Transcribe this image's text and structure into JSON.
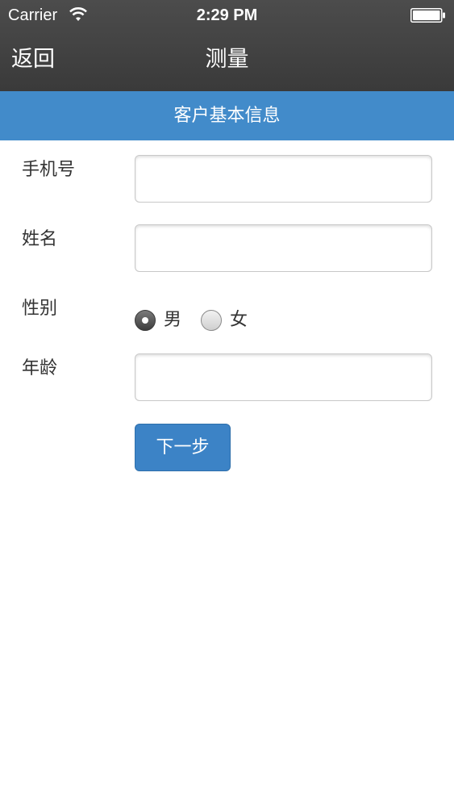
{
  "status_bar": {
    "carrier": "Carrier",
    "time": "2:29 PM",
    "wifi_icon": "wifi-icon",
    "battery_icon": "battery-icon"
  },
  "nav": {
    "back_label": "返回",
    "title": "测量"
  },
  "section": {
    "title": "客户基本信息"
  },
  "form": {
    "phone": {
      "label": "手机号",
      "value": "",
      "placeholder": ""
    },
    "name": {
      "label": "姓名",
      "value": "",
      "placeholder": ""
    },
    "gender": {
      "label": "性别",
      "options": [
        {
          "label": "男",
          "selected": true
        },
        {
          "label": "女",
          "selected": false
        }
      ]
    },
    "age": {
      "label": "年龄",
      "value": "",
      "placeholder": ""
    },
    "next_label": "下一步"
  },
  "colors": {
    "nav_bg": "#434343",
    "header_bg": "#428bca",
    "button_bg": "#3c83c6"
  }
}
